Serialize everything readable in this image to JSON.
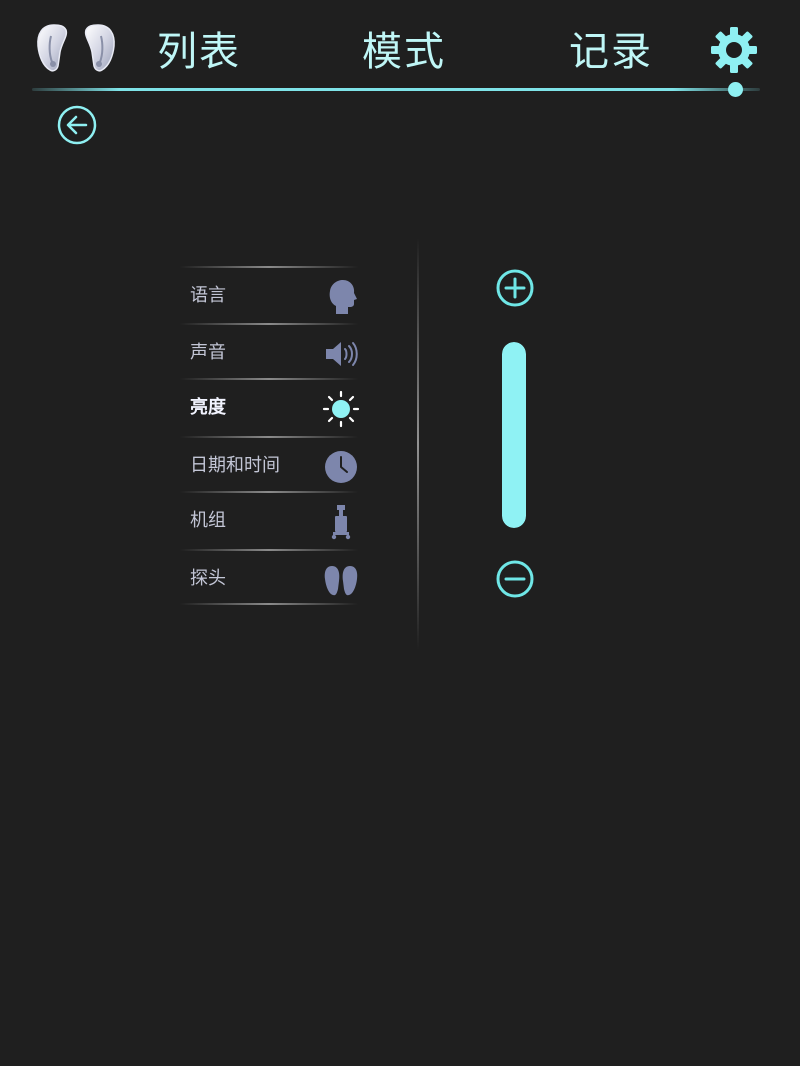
{
  "header": {
    "nav": {
      "list": "列表",
      "mode": "模式",
      "record": "记录"
    },
    "icons": {
      "probes": "probe-pair-icon",
      "settings": "gear-icon",
      "back": "back-arrow-icon"
    }
  },
  "settings_menu": {
    "items": [
      {
        "label": "语言",
        "icon": "head-profile-icon"
      },
      {
        "label": "声音",
        "icon": "speaker-icon"
      },
      {
        "label": "亮度",
        "icon": "sun-icon",
        "active": true
      },
      {
        "label": "日期和时间",
        "icon": "clock-icon"
      },
      {
        "label": "机组",
        "icon": "device-cart-icon"
      },
      {
        "label": "探头",
        "icon": "earpiece-probe-icon"
      }
    ]
  },
  "brightness": {
    "level_fraction": 1.0,
    "increase_icon": "plus-circle-icon",
    "decrease_icon": "minus-circle-icon"
  },
  "colors": {
    "background": "#1f1f1f",
    "accent": "#8ff2f4",
    "nav_text": "#bff6f6",
    "menu_text": "#c3c6d6",
    "menu_icon": "#7d86ac"
  }
}
